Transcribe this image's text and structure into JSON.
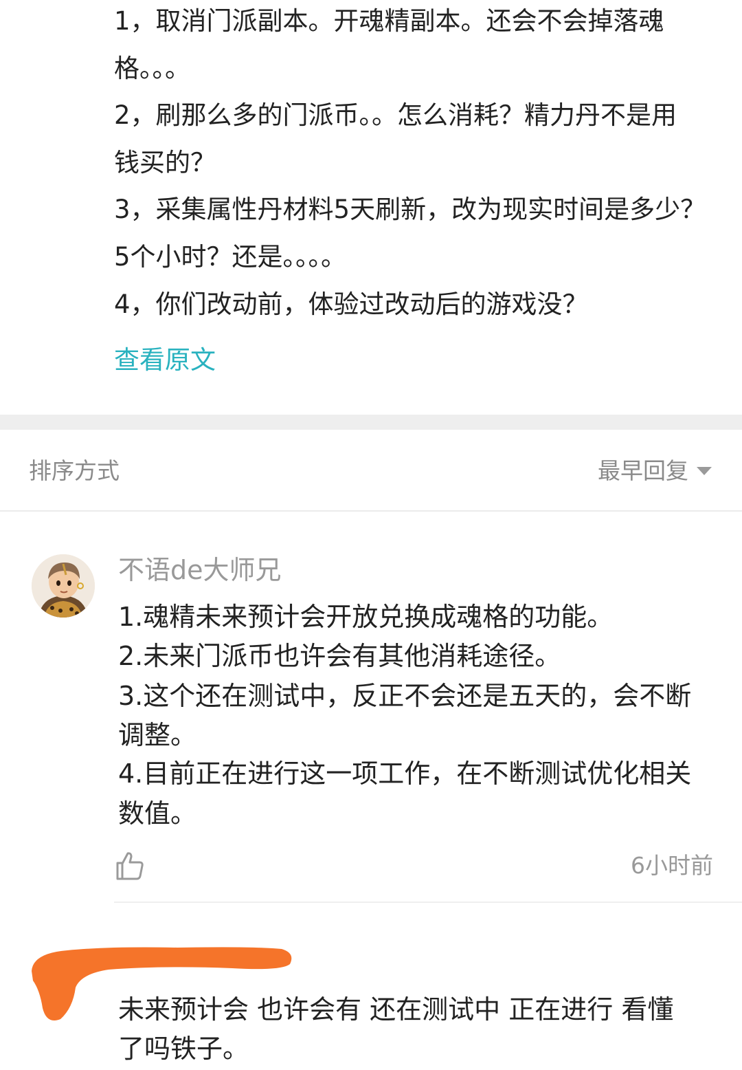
{
  "post": {
    "lines": [
      "1，取消门派副本。开魂精副本。还会不会掉落魂",
      "格。。。",
      "2，刷那么多的门派币。。怎么消耗？精力丹不是用",
      "钱买的？",
      "3，采集属性丹材料5天刷新，改为现实时间是多少？",
      "5个小时？还是。。。。",
      "4，你们改动前，体验过改动后的游戏没？"
    ],
    "view_original_label": "查看原文",
    "link_color": "#29b2bf"
  },
  "sort": {
    "label": "排序方式",
    "selected": "最早回复",
    "caret_icon": "caret-down-icon"
  },
  "replies": [
    {
      "username": "不语de大师兄",
      "avatar_icon": "avatar-icon",
      "lines": [
        "1.魂精未来预计会开放兑换成魂格的功能。",
        "2.未来门派币也许会有其他消耗途径。",
        "3.这个还在测试中，反正不会还是五天的，会不断",
        "调整。",
        "4.目前正在进行这一项工作，在不断测试优化相关",
        "数值。"
      ],
      "like_icon": "thumbs-up-icon",
      "time": "6小时前"
    },
    {
      "username_hidden": true,
      "lines": [
        "未来预计会 也许会有 还在测试中 正在进行  看懂",
        "了吗铁子。"
      ]
    }
  ],
  "colors": {
    "censor": "#f5742a",
    "divider": "#eeeeee"
  }
}
